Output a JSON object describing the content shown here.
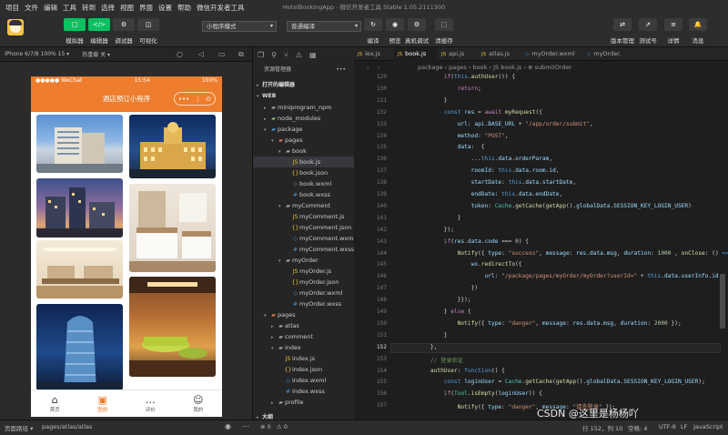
{
  "menubar": {
    "items": [
      "项目",
      "文件",
      "编辑",
      "工具",
      "转到",
      "选择",
      "视图",
      "界面",
      "设置",
      "帮助",
      "微信开发者工具"
    ],
    "title": "HotelBookingApp - 微信开发者工具 Stable 1.05.2111300"
  },
  "toolbar": {
    "left_buttons": [
      {
        "label": "模拟器",
        "icon": "□",
        "color": "#07c160"
      },
      {
        "label": "编辑器",
        "icon": "</>",
        "color": "#07c160"
      },
      {
        "label": "调试器",
        "icon": "⚙",
        "color": "#3c3c3c"
      },
      {
        "label": "可视化",
        "icon": "◫",
        "color": "#3c3c3c"
      }
    ],
    "mode_select": "小程序模式",
    "compile_select": "普通编译",
    "mid_buttons": [
      {
        "label": "编译",
        "icon": "↻"
      },
      {
        "label": "预览",
        "icon": "◉"
      },
      {
        "label": "真机调试",
        "icon": "⚙"
      },
      {
        "label": "清缓存",
        "icon": "⬚"
      }
    ],
    "right_buttons": [
      {
        "label": "版本管理",
        "icon": "⇄"
      },
      {
        "label": "测试号",
        "icon": "⇗"
      },
      {
        "label": "详情",
        "icon": "≡"
      },
      {
        "label": "消息",
        "icon": "🔔"
      }
    ]
  },
  "simbar": {
    "device": "iPhone 6/7/8 100% 15 ▾",
    "hotreload": "热重载 关 ▾"
  },
  "phone": {
    "carrier": "●●●●● WeChat",
    "time": "15:54",
    "battery": "100%",
    "nav_title": "酒店预订小程序",
    "capsule_more": "•••",
    "capsule_close": "⊙",
    "tabs": [
      {
        "icon": "⌂",
        "label": "首页",
        "active": false
      },
      {
        "icon": "▣",
        "label": "图册",
        "active": true
      },
      {
        "icon": "…",
        "label": "评价",
        "active": false
      },
      {
        "icon": "☺",
        "label": "我的",
        "active": false
      }
    ]
  },
  "explorer": {
    "header_icons": [
      "❐",
      "⚲",
      "⑂",
      "⚠",
      "▦"
    ],
    "title": "资源管理器",
    "more": "•••",
    "open_editors": "打开的编辑器",
    "web": "WEB",
    "tree": [
      {
        "d": 1,
        "t": "dir",
        "c": "▸",
        "name": "miniprogram_npm",
        "ic": "▰",
        "col": "#a9a9a9"
      },
      {
        "d": 1,
        "t": "dir",
        "c": "▸",
        "name": "node_modules",
        "ic": "▰",
        "col": "#8fbf6b"
      },
      {
        "d": 1,
        "t": "dir",
        "c": "▾",
        "name": "package",
        "ic": "▰",
        "col": "#4e94ce"
      },
      {
        "d": 2,
        "t": "dir",
        "c": "▾",
        "name": "pages",
        "ic": "▰",
        "col": "#e07b53"
      },
      {
        "d": 3,
        "t": "dir",
        "c": "▾",
        "name": "book",
        "ic": "▰",
        "col": "#a9a9a9"
      },
      {
        "d": 4,
        "t": "file",
        "name": "book.js",
        "ic": "JS",
        "col": "#e6c13b",
        "sel": true
      },
      {
        "d": 4,
        "t": "file",
        "name": "book.json",
        "ic": "{}",
        "col": "#e6c13b"
      },
      {
        "d": 4,
        "t": "file",
        "name": "book.wxml",
        "ic": "◇",
        "col": "#4e94ce"
      },
      {
        "d": 4,
        "t": "file",
        "name": "book.wxss",
        "ic": "#",
        "col": "#4e94ce"
      },
      {
        "d": 3,
        "t": "dir",
        "c": "▾",
        "name": "myComment",
        "ic": "▰",
        "col": "#a9a9a9"
      },
      {
        "d": 4,
        "t": "file",
        "name": "myComment.js",
        "ic": "JS",
        "col": "#e6c13b"
      },
      {
        "d": 4,
        "t": "file",
        "name": "myComment.json",
        "ic": "{}",
        "col": "#e6c13b"
      },
      {
        "d": 4,
        "t": "file",
        "name": "myComment.wxml",
        "ic": "◇",
        "col": "#4e94ce"
      },
      {
        "d": 4,
        "t": "file",
        "name": "myComment.wxss",
        "ic": "#",
        "col": "#4e94ce"
      },
      {
        "d": 3,
        "t": "dir",
        "c": "▾",
        "name": "myOrder",
        "ic": "▰",
        "col": "#a9a9a9"
      },
      {
        "d": 4,
        "t": "file",
        "name": "myOrder.js",
        "ic": "JS",
        "col": "#e6c13b"
      },
      {
        "d": 4,
        "t": "file",
        "name": "myOrder.json",
        "ic": "{}",
        "col": "#e6c13b"
      },
      {
        "d": 4,
        "t": "file",
        "name": "myOrder.wxml",
        "ic": "◇",
        "col": "#4e94ce"
      },
      {
        "d": 4,
        "t": "file",
        "name": "myOrder.wxss",
        "ic": "#",
        "col": "#4e94ce"
      },
      {
        "d": 1,
        "t": "dir",
        "c": "▾",
        "name": "pages",
        "ic": "▰",
        "col": "#e07b53"
      },
      {
        "d": 2,
        "t": "dir",
        "c": "▸",
        "name": "atlas",
        "ic": "▰",
        "col": "#a9a9a9"
      },
      {
        "d": 2,
        "t": "dir",
        "c": "▸",
        "name": "comment",
        "ic": "▰",
        "col": "#a9a9a9"
      },
      {
        "d": 2,
        "t": "dir",
        "c": "▾",
        "name": "index",
        "ic": "▰",
        "col": "#a9a9a9"
      },
      {
        "d": 3,
        "t": "file",
        "name": "index.js",
        "ic": "JS",
        "col": "#e6c13b"
      },
      {
        "d": 3,
        "t": "file",
        "name": "index.json",
        "ic": "{}",
        "col": "#e6c13b"
      },
      {
        "d": 3,
        "t": "file",
        "name": "index.wxml",
        "ic": "◇",
        "col": "#4e94ce"
      },
      {
        "d": 3,
        "t": "file",
        "name": "index.wxss",
        "ic": "#",
        "col": "#4e94ce"
      },
      {
        "d": 2,
        "t": "dir",
        "c": "▸",
        "name": "profile",
        "ic": "▰",
        "col": "#a9a9a9"
      }
    ],
    "outline": "大纲"
  },
  "editor": {
    "tabs": [
      {
        "name": "lex.js",
        "ic": "JS"
      },
      {
        "name": "book.js",
        "ic": "JS",
        "active": true
      },
      {
        "name": "api.js",
        "ic": "JS"
      },
      {
        "name": "atlas.js",
        "ic": "JS"
      },
      {
        "name": "myOrder.wxml",
        "ic": "◇"
      },
      {
        "name": "myOrder.",
        "ic": "◇"
      }
    ],
    "breadcrumb": "package › pages › book › JS book.js › ⊕ submitOrder",
    "lines": [
      {
        "n": "129",
        "h": "        <span class='k'>if</span>(<span class='kb'>this</span>.<span class='f'>authUser</span>()) {"
      },
      {
        "n": "130",
        "h": "            <span class='k'>return</span>;"
      },
      {
        "n": "131",
        "h": "        }"
      },
      {
        "n": "132",
        "h": "        <span class='kb'>const</span> <span class='p'>res</span> = <span class='k'>await</span> <span class='f'>myRequest</span>({"
      },
      {
        "n": "133",
        "h": "            <span class='p'>url</span>: <span class='p'>api</span>.<span class='p'>BASE_URL</span> + <span class='s'>\"/app/order/submit\"</span>,"
      },
      {
        "n": "134",
        "h": "            <span class='p'>method</span>: <span class='s'>\"POST\"</span>,"
      },
      {
        "n": "135",
        "h": "            <span class='p'>data</span>:  {"
      },
      {
        "n": "136",
        "h": "                ...<span class='kb'>this</span>.<span class='p'>data</span>.<span class='p'>orderParam</span>,"
      },
      {
        "n": "137",
        "h": "                <span class='p'>roomId</span>: <span class='kb'>this</span>.<span class='p'>data</span>.<span class='p'>room</span>.<span class='p'>id</span>,"
      },
      {
        "n": "138",
        "h": "                <span class='p'>startDate</span>: <span class='kb'>this</span>.<span class='p'>data</span>.<span class='p'>startDate</span>,"
      },
      {
        "n": "139",
        "h": "                <span class='p'>endDate</span>: <span class='kb'>this</span>.<span class='p'>data</span>.<span class='p'>endDate</span>,"
      },
      {
        "n": "140",
        "h": "                <span class='p'>token</span>: <span class='t'>Cache</span>.<span class='f'>getCache</span>(<span class='f'>getApp</span>().<span class='p'>globalData</span>.<span class='p'>SESSION_KEY_LOGIN_USER</span>)"
      },
      {
        "n": "141",
        "h": "            }"
      },
      {
        "n": "142",
        "h": "        });"
      },
      {
        "n": "143",
        "h": "        <span class='k'>if</span>(<span class='p'>res</span>.<span class='p'>data</span>.<span class='p'>code</span> === <span class='n'>0</span>) {"
      },
      {
        "n": "144",
        "h": "            <span class='f'>Notify</span>({ <span class='p'>type</span>: <span class='s'>\"success\"</span>, <span class='p'>message</span>: <span class='p'>res</span>.<span class='p'>data</span>.<span class='p'>msg</span>, <span class='p'>duration</span>: <span class='n'>1000</span> , <span class='f'>onClose</span>: () <span class='kb'>=&gt;</span> {"
      },
      {
        "n": "145",
        "h": "                <span class='p'>wx</span>.<span class='f'>redirectTo</span>({"
      },
      {
        "n": "146",
        "h": "                    <span class='p'>url</span>: <span class='s'>\"/package/pages/myOrder/myOrder?userId=\"</span> + <span class='kb'>this</span>.<span class='p'>data</span>.<span class='p'>userInfo</span>.<span class='p'>id</span>"
      },
      {
        "n": "147",
        "h": "                })"
      },
      {
        "n": "148",
        "h": "            }});"
      },
      {
        "n": "149",
        "h": "        } <span class='k'>else</span> {"
      },
      {
        "n": "150",
        "h": "            <span class='f'>Notify</span>({ <span class='p'>type</span>: <span class='s'>\"danger\"</span>, <span class='p'>message</span>: <span class='p'>res</span>.<span class='p'>data</span>.<span class='p'>msg</span>, <span class='p'>duration</span>: <span class='n'>2000</span> });"
      },
      {
        "n": "151",
        "h": "        }"
      },
      {
        "n": "152",
        "h": "    },",
        "cur": true
      },
      {
        "n": "153",
        "h": "    <span class='c'>// 登录验证</span>"
      },
      {
        "n": "154",
        "h": "    <span class='f'>authUser</span>: <span class='kb'>function</span>() {"
      },
      {
        "n": "155",
        "h": "        <span class='kb'>const</span> <span class='p'>loginUser</span> = <span class='t'>Cache</span>.<span class='f'>getCache</span>(<span class='f'>getApp</span>().<span class='p'>globalData</span>.<span class='p'>SESSION_KEY_LOGIN_USER</span>);"
      },
      {
        "n": "156",
        "h": "        <span class='k'>if</span>(<span class='t'>Tool</span>.<span class='f'>isEmpty</span>(<span class='p'>loginUser</span>)) {"
      },
      {
        "n": "157",
        "h": "            <span class='f'>Notify</span>({ <span class='p'>type</span>: <span class='s'>\"danger\"</span>, <span class='p'>message</span>: <span class='s'>\"请先登录\"</span> });"
      }
    ]
  },
  "statusbar": {
    "page_path_label": "页面路径 ▾",
    "page_path": "pages/atlas/atlas",
    "errors": "⊗ 0",
    "warnings": "⚠ 0",
    "cursor": "行 152，列 10",
    "spaces": "空格: 4",
    "encoding": "UTF-8",
    "eol": "LF",
    "language": "JavaScript"
  },
  "watermark": "CSDN @这里是杨杨吖",
  "colors": {
    "accent": "#ee7d2d",
    "green": "#07c160"
  }
}
